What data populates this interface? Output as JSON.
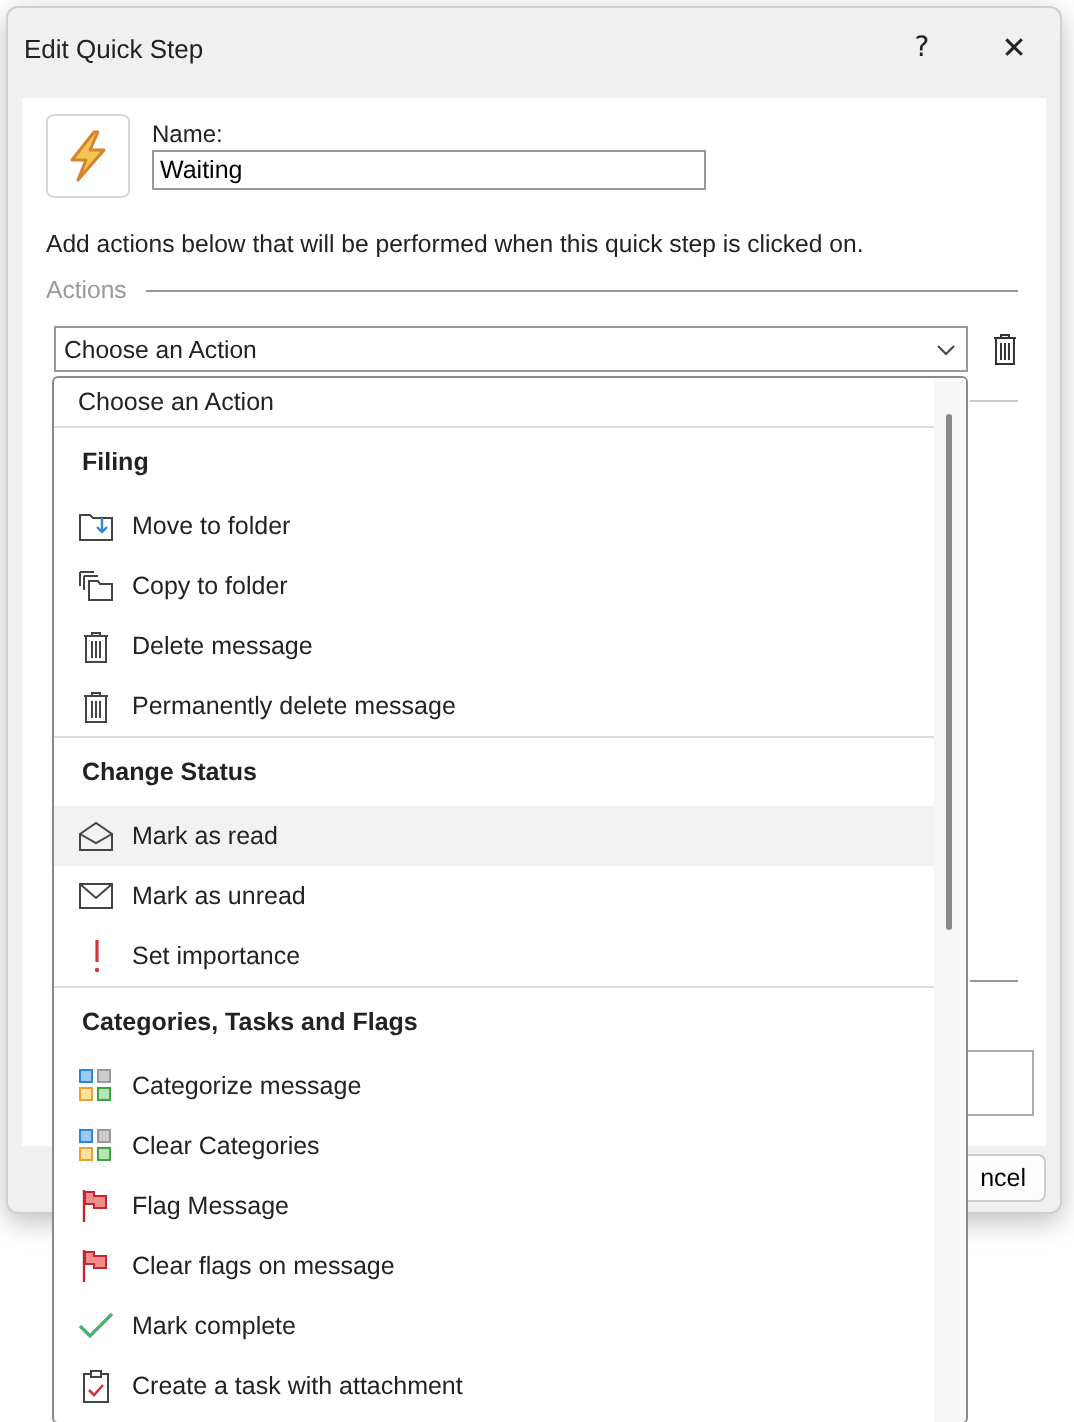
{
  "window": {
    "title": "Edit Quick Step",
    "help": "?",
    "close": "✕"
  },
  "name_label": "Name:",
  "name_value": "Waiting",
  "description": "Add actions below that will be performed when this quick step is clicked on.",
  "actions_legend": "Actions",
  "action_combo": {
    "value": "Choose an Action"
  },
  "cancel_button": "ncel",
  "dropdown": {
    "first": "Choose an Action",
    "groups": [
      {
        "title": "Filing",
        "items": [
          {
            "label": "Move to folder",
            "kind": "move",
            "highlighted": false
          },
          {
            "label": "Copy to folder",
            "kind": "copy",
            "highlighted": false
          },
          {
            "label": "Delete message",
            "kind": "trash",
            "highlighted": false
          },
          {
            "label": "Permanently delete message",
            "kind": "trash",
            "highlighted": false
          }
        ]
      },
      {
        "title": "Change Status",
        "items": [
          {
            "label": "Mark as read",
            "kind": "open-mail",
            "highlighted": true
          },
          {
            "label": "Mark as unread",
            "kind": "mail",
            "highlighted": false
          },
          {
            "label": "Set importance",
            "kind": "important",
            "highlighted": false
          }
        ]
      },
      {
        "title": "Categories, Tasks and Flags",
        "items": [
          {
            "label": "Categorize message",
            "kind": "categories",
            "highlighted": false
          },
          {
            "label": "Clear Categories",
            "kind": "categories",
            "highlighted": false
          },
          {
            "label": "Flag Message",
            "kind": "flag",
            "highlighted": false
          },
          {
            "label": "Clear flags on message",
            "kind": "flag",
            "highlighted": false
          },
          {
            "label": "Mark complete",
            "kind": "check",
            "highlighted": false
          },
          {
            "label": "Create a task with attachment",
            "kind": "task",
            "highlighted": false
          }
        ]
      }
    ]
  }
}
